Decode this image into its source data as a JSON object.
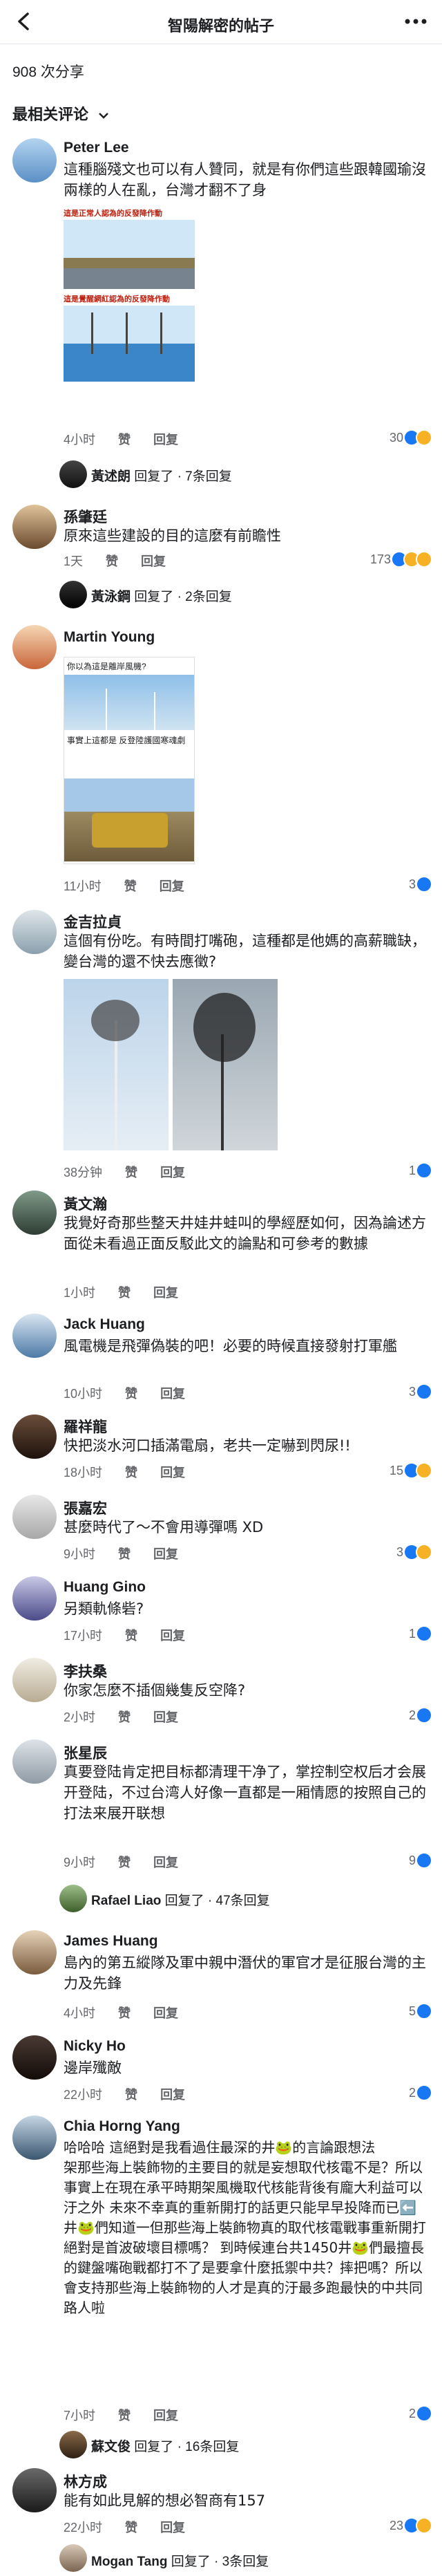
{
  "header": {
    "title": "智陽解密的帖子"
  },
  "shares": "908 次分享",
  "sort_label": "最相关评论",
  "comments": [
    {
      "name": "Peter Lee",
      "text": "這種腦殘文也可以有人贊同，就是有你們這些跟韓國瑜沒兩樣的人在亂，台灣才翻不了身",
      "time": "4小时",
      "like": "赞",
      "reply": "回复",
      "count": "30",
      "img_caption_1": "這是正常人認為的反發降作動",
      "img_caption_2": "這是覺醒網紅認為的反發降作動",
      "replier": "黃述朗",
      "reply_summary": "回复了 · 7条回复"
    },
    {
      "name": "孫肇廷",
      "text": "原來這些建設的目的這麼有前瞻性",
      "time": "1天",
      "like": "赞",
      "reply": "回复",
      "count": "173",
      "replier": "黃泳鋼",
      "reply_summary": "回复了 · 2条回复"
    },
    {
      "name": "Martin Young",
      "time": "11小时",
      "like": "赞",
      "reply": "回复",
      "count": "3",
      "img_caption_1": "你以為這是離岸風機?",
      "img_caption_2": "事實上這都是 反登陸護國寒魂劇"
    },
    {
      "name": "金吉拉貞",
      "text": "這個有份吃。有時間打嘴砲，這種都是他媽的高薪職缺，變台灣的還不快去應徵?",
      "time": "38分钟",
      "like": "赞",
      "reply": "回复",
      "count": "1"
    },
    {
      "name": "黃文瀚",
      "text": "我覺好奇那些整天井娃井蛙叫的學經歷如何，因為論述方面從未看過正面反駁此文的論點和可參考的數據",
      "time": "1小时",
      "like": "赞",
      "reply": "回复"
    },
    {
      "name": "Jack Huang",
      "text": "風電機是飛彈偽裝的吧！必要的時候直接發射打軍艦",
      "time": "10小时",
      "like": "赞",
      "reply": "回复",
      "count": "3"
    },
    {
      "name": "羅祥龍",
      "text": "快把淡水河口插滿電扇，老共一定嚇到閃尿!!",
      "time": "18小时",
      "like": "赞",
      "reply": "回复",
      "count": "15"
    },
    {
      "name": "張嘉宏",
      "text": "甚麼時代了～不會用導彈嗎 XD",
      "time": "9小时",
      "like": "赞",
      "reply": "回复",
      "count": "3"
    },
    {
      "name": "Huang Gino",
      "text": "另類軌條砦?",
      "time": "17小时",
      "like": "赞",
      "reply": "回复",
      "count": "1"
    },
    {
      "name": "李扶桑",
      "text": "你家怎麼不插個幾隻反空降?",
      "time": "2小时",
      "like": "赞",
      "reply": "回复",
      "count": "2"
    },
    {
      "name": "张星辰",
      "text": "真要登陆肯定把目标都清理干净了，掌控制空权后才会展开登陆，不过台湾人好像一直都是一厢情愿的按照自己的打法来展开联想",
      "time": "9小时",
      "like": "赞",
      "reply": "回复",
      "count": "9",
      "replier": "Rafael Liao",
      "reply_summary": "回复了 · 47条回复"
    },
    {
      "name": "James Huang",
      "text": "島內的第五縱隊及軍中親中潛伏的軍官才是征服台灣的主力及先鋒",
      "time": "4小时",
      "like": "赞",
      "reply": "回复",
      "count": "5"
    },
    {
      "name": "Nicky Ho",
      "text": "邊岸殲敵",
      "time": "22小时",
      "like": "赞",
      "reply": "回复",
      "count": "2"
    },
    {
      "name": "Chia Horng Yang",
      "text": "哈哈哈 這絕對是我看過住最深的井🐸的言論跟想法\n架那些海上裝飾物的主要目的就是妄想取代核電不是？所以事實上在現在承平時期架風機取代核能背後有龐大利益可以汙之外 未來不幸真的重新開打的話更只能早早投降而已⬅️井🐸們知道一但那些海上裝飾物真的取代核電戰事重新開打絕對是首波破壞目標嗎？ 到時候連台共1450井🐸們最擅長的鍵盤嘴砲戰都打不了是要拿什麼抵禦中共？摔把嗎？所以會支持那些海上裝飾物的人才是真的汙最多跑最快的中共同路人啦",
      "time": "7小时",
      "like": "赞",
      "reply": "回复",
      "count": "2",
      "replier": "蘇文俊",
      "reply_summary": "回复了 · 16条回复"
    },
    {
      "name": "林方成",
      "text": "能有如此見解的想必智商有157",
      "time": "22小时",
      "like": "赞",
      "reply": "回复",
      "count": "23",
      "replier": "Mogan Tang",
      "reply_summary": "回复了 · 3条回复"
    }
  ],
  "colors": {
    "accent": "#1877f2",
    "muted": "#65676b"
  }
}
